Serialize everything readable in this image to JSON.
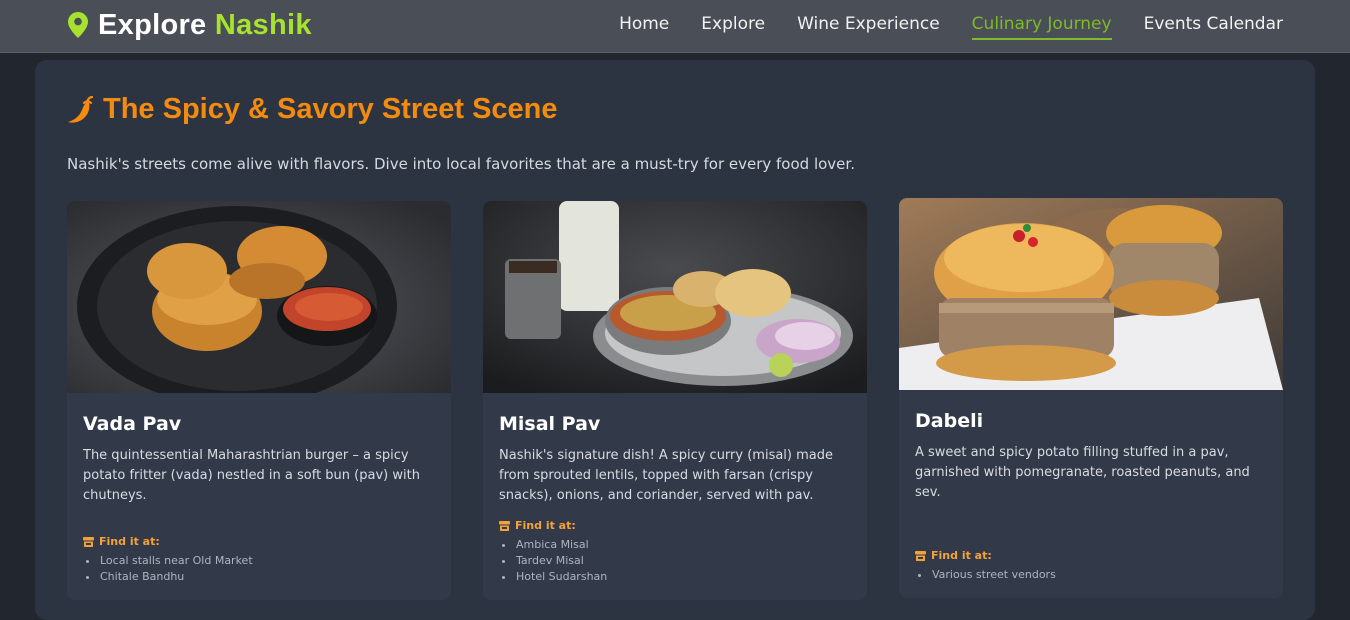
{
  "brand": {
    "name": "Explore",
    "accent": "Nashik",
    "icon": "map-pin-icon",
    "accent_color": "#a6e22e"
  },
  "nav": {
    "items": [
      {
        "label": "Home"
      },
      {
        "label": "Explore"
      },
      {
        "label": "Wine Experience"
      },
      {
        "label": "Culinary Journey",
        "active": true
      },
      {
        "label": "Events Calendar"
      }
    ]
  },
  "section": {
    "icon": "chili-pepper-icon",
    "title": "The Spicy & Savory Street Scene",
    "intro": "Nashik's streets come alive with flavors. Dive into local favorites that are a must-try for every food lover.",
    "title_color": "#f48b0f"
  },
  "find_label": "Find it at:",
  "cards": [
    {
      "name": "Vada Pav",
      "description": "The quintessential Maharashtrian burger – a spicy potato fritter (vada) nestled in a soft bun (pav) with chutneys.",
      "locations": [
        "Local stalls near Old Market",
        "Chitale Bandhu"
      ]
    },
    {
      "name": "Misal Pav",
      "description": "Nashik's signature dish! A spicy curry (misal) made from sprouted lentils, topped with farsan (crispy snacks), onions, and coriander, served with pav.",
      "locations": [
        "Ambica Misal",
        "Tardev Misal",
        "Hotel Sudarshan"
      ]
    },
    {
      "name": "Dabeli",
      "description": "A sweet and spicy potato filling stuffed in a pav, garnished with pomegranate, roasted peanuts, and sev.",
      "locations": [
        "Various street vendors"
      ]
    }
  ]
}
